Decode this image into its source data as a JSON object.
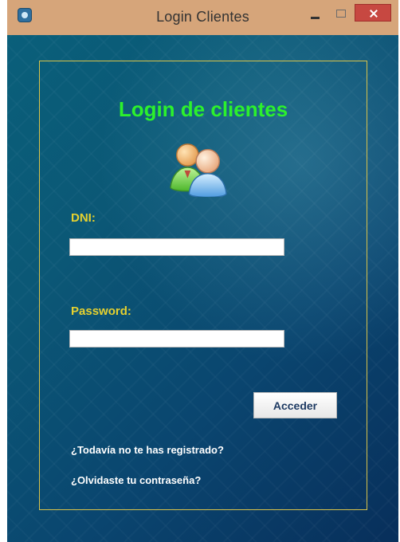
{
  "window": {
    "title": "Login Clientes"
  },
  "login": {
    "heading": "Login de clientes",
    "dni_label": "DNI:",
    "password_label": "Password:",
    "dni_value": "",
    "password_value": "",
    "submit_label": "Acceder",
    "register_link": "¿Todavía no te has registrado?",
    "forgot_link": "¿Olvidaste tu contraseña?"
  },
  "icons": {
    "app": "app-icon",
    "users": "users-icon",
    "minimize": "minimize-icon",
    "maximize": "maximize-icon",
    "close": "close-icon"
  },
  "colors": {
    "heading": "#2cf12c",
    "labels": "#e6d12f",
    "panel_border": "#d8c24a",
    "close_button": "#c74841"
  }
}
